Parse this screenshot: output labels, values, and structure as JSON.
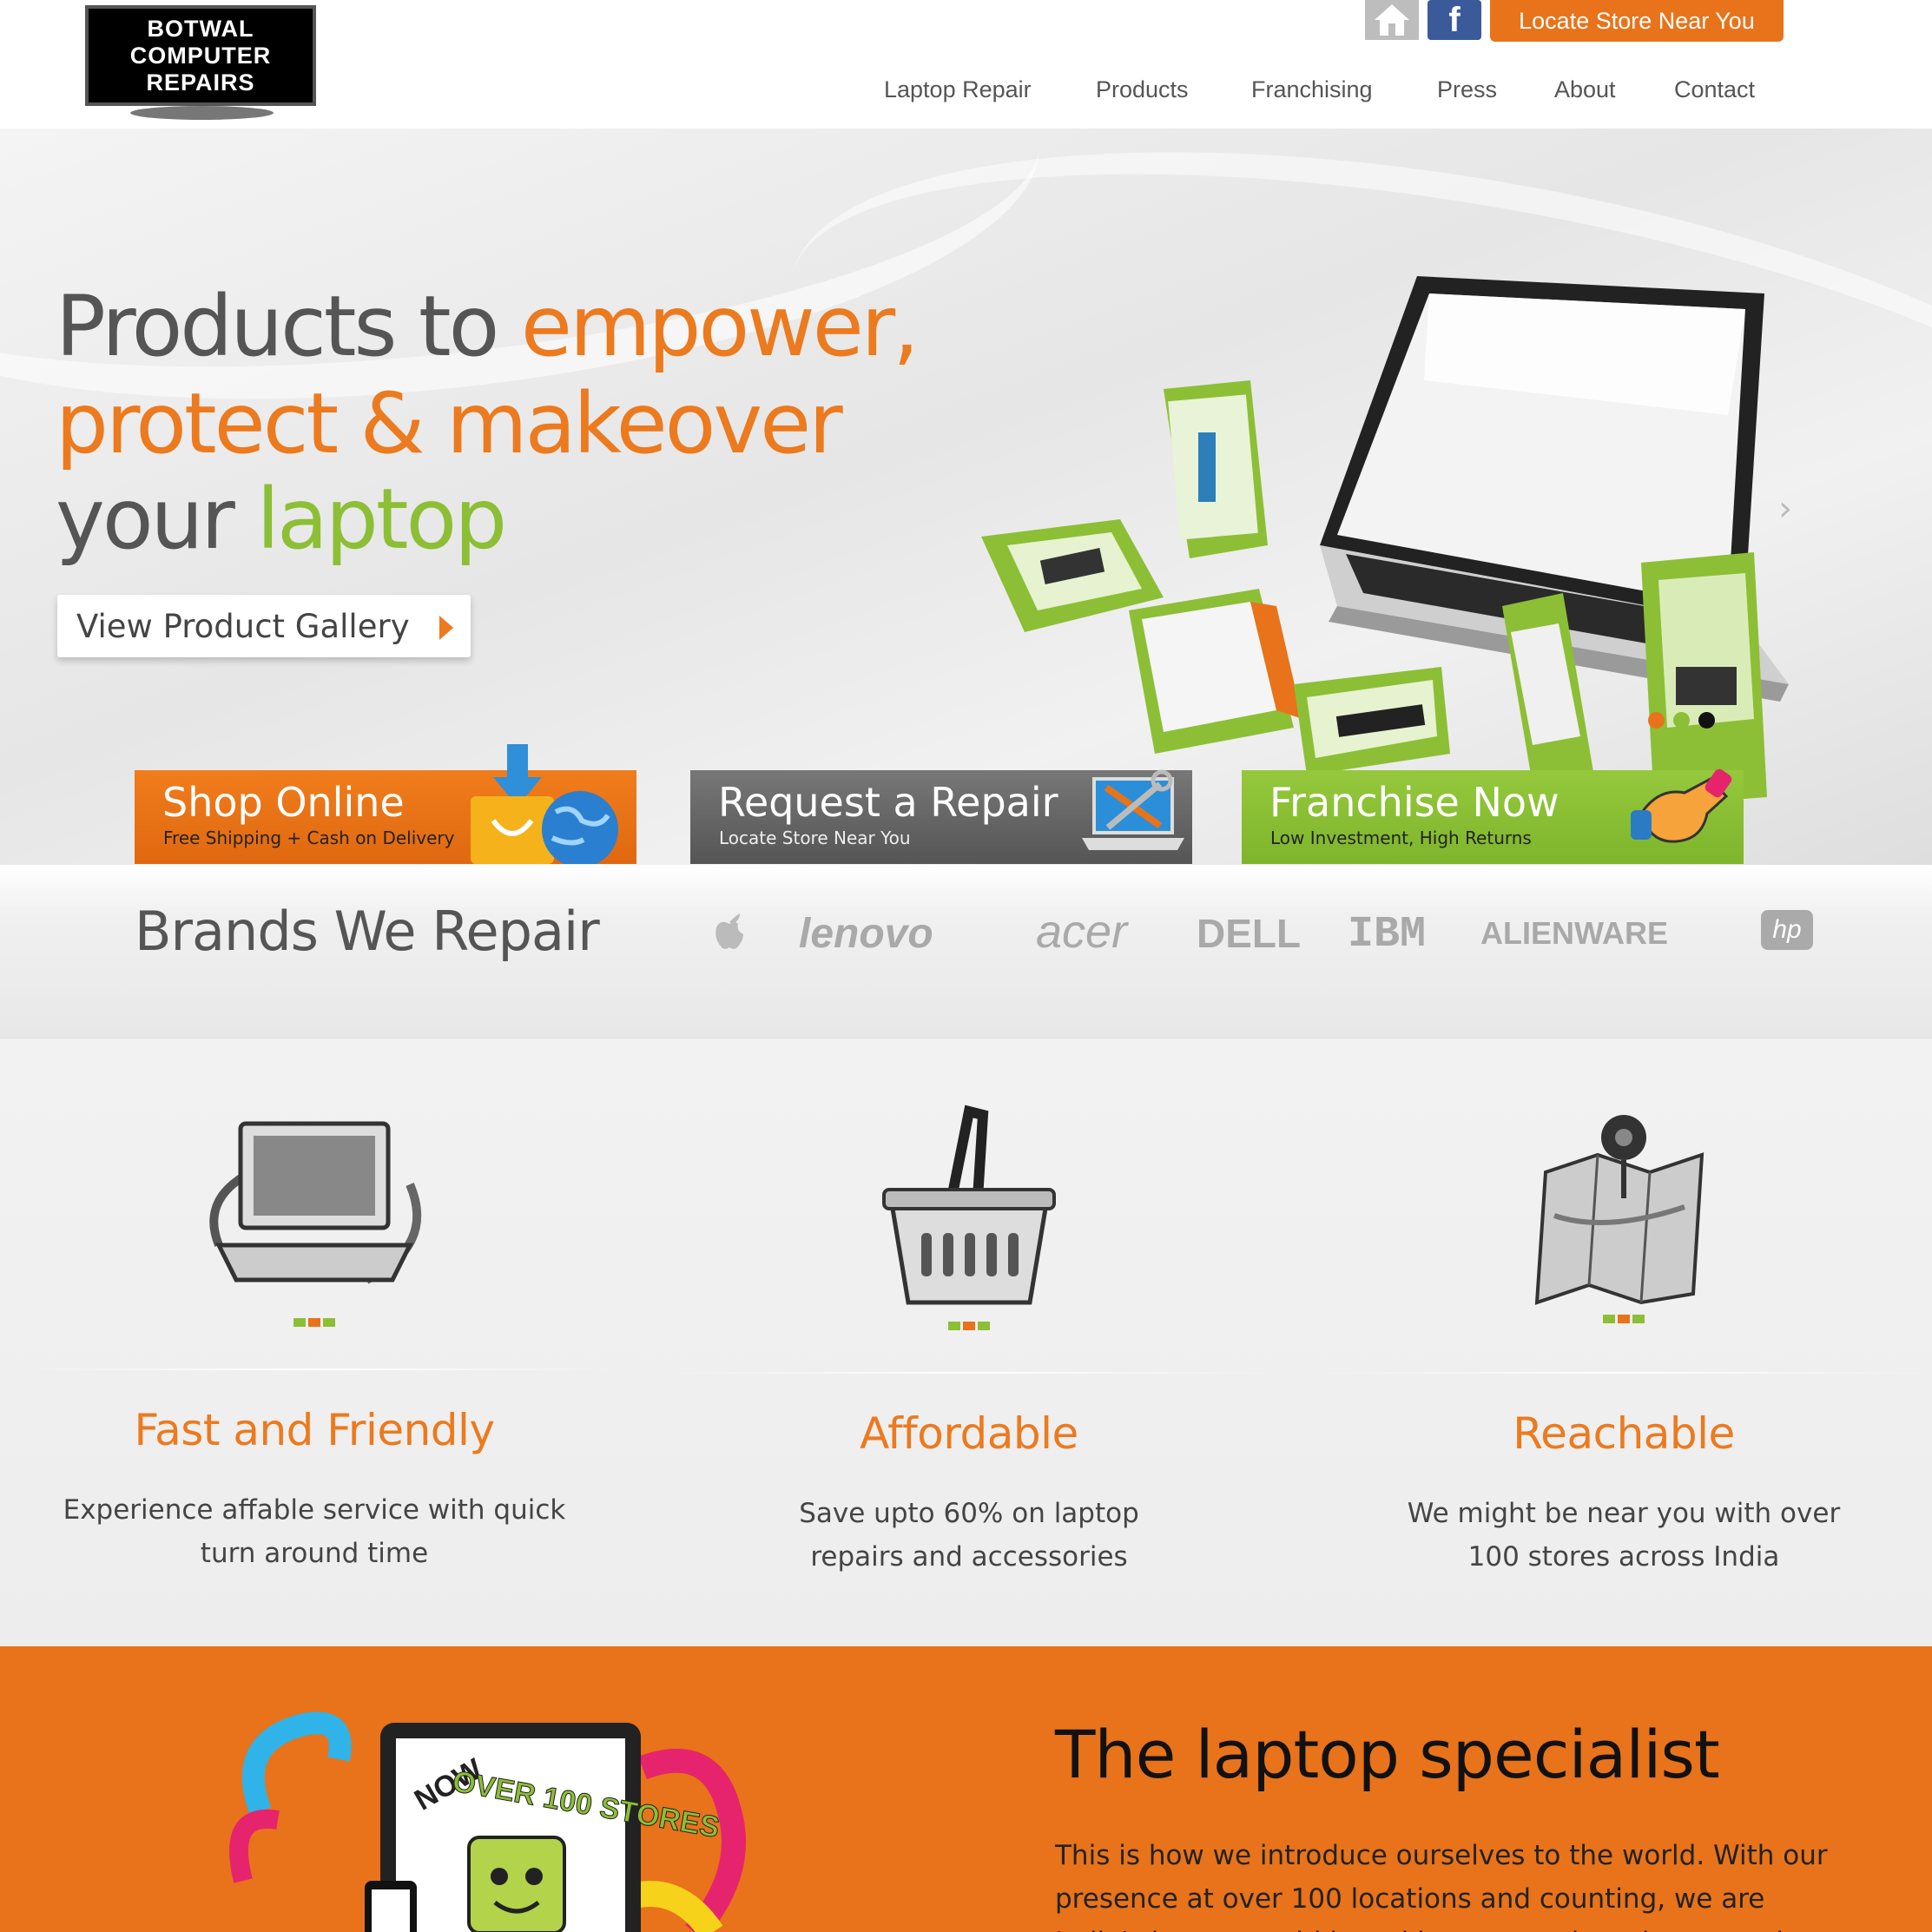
{
  "header": {
    "logo_lines": [
      "BOTWAL",
      "COMPUTER",
      "REPAIRS"
    ],
    "locate_store": "Locate Store Near You",
    "nav": [
      "Laptop Repair",
      "Products",
      "Franchising",
      "Press",
      "About",
      "Contact"
    ]
  },
  "hero": {
    "line1_part1": "Products to ",
    "line1_part2": "empower,",
    "line2": "protect & makeover",
    "line3_part1": "your ",
    "line3_part2": "laptop",
    "gallery_button": "View Product Gallery",
    "slide_dots": [
      "#e8731a",
      "#8cbf35",
      "#111111"
    ]
  },
  "cta": {
    "shop": {
      "title": "Shop Online",
      "subtitle": "Free Shipping + Cash on Delivery"
    },
    "repair": {
      "title": "Request a Repair",
      "subtitle": "Locate Store Near You"
    },
    "franchise": {
      "title": "Franchise Now",
      "subtitle": "Low Investment, High Returns"
    }
  },
  "brands": {
    "title": "Brands We Repair",
    "logos": [
      "apple-icon",
      "lenovo",
      "acer",
      "DELL",
      "IBM",
      "ALIENWARE",
      "hp"
    ]
  },
  "features": [
    {
      "icon": "laptop-refresh-icon",
      "title": "Fast and Friendly",
      "text": "Experience affable service with quick turn around time"
    },
    {
      "icon": "shopping-basket-icon",
      "title": "Affordable",
      "text": "Save upto 60% on laptop repairs and accessories"
    },
    {
      "icon": "map-pin-icon",
      "title": "Reachable",
      "text": "We might be near you with over 100 stores across India"
    }
  ],
  "specialist": {
    "title": "The laptop specialist",
    "text": "This is how we introduce ourselves to the world. With our presence at over 100 locations and counting, we are India's largest multi brand laptop repair and accessories network. At",
    "badge_now": "NOW",
    "badge_main": "OVER 100 STORES"
  },
  "colors": {
    "orange": "#e8731a",
    "green": "#8cbf35",
    "facebook": "#3b5a9a"
  }
}
